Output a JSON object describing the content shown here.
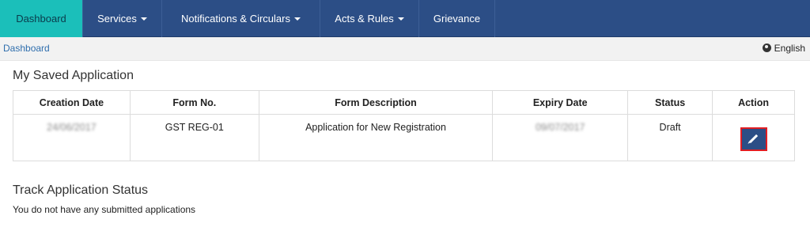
{
  "nav": {
    "items": [
      {
        "label": "Dashboard",
        "dropdown": false,
        "active": true
      },
      {
        "label": "Services",
        "dropdown": true,
        "active": false
      },
      {
        "label": "Notifications & Circulars",
        "dropdown": true,
        "active": false
      },
      {
        "label": "Acts & Rules",
        "dropdown": true,
        "active": false
      },
      {
        "label": "Grievance",
        "dropdown": false,
        "active": false
      }
    ]
  },
  "breadcrumb": {
    "label": "Dashboard"
  },
  "language": {
    "label": "English",
    "icon": "globe-icon"
  },
  "saved_applications": {
    "title": "My Saved Application",
    "columns": [
      "Creation Date",
      "Form No.",
      "Form Description",
      "Expiry Date",
      "Status",
      "Action"
    ],
    "rows": [
      {
        "creation_date": "24/06/2017",
        "form_no": "GST REG-01",
        "description": "Application for New Registration",
        "expiry_date": "09/07/2017",
        "status": "Draft",
        "action_icon": "pencil-icon"
      }
    ]
  },
  "track": {
    "title": "Track Application Status",
    "message": "You do not have any submitted applications"
  },
  "colors": {
    "nav_bg": "#2c4e86",
    "nav_active_bg": "#1bbfba",
    "link": "#2f6ead",
    "highlight_border": "#e11d22"
  }
}
